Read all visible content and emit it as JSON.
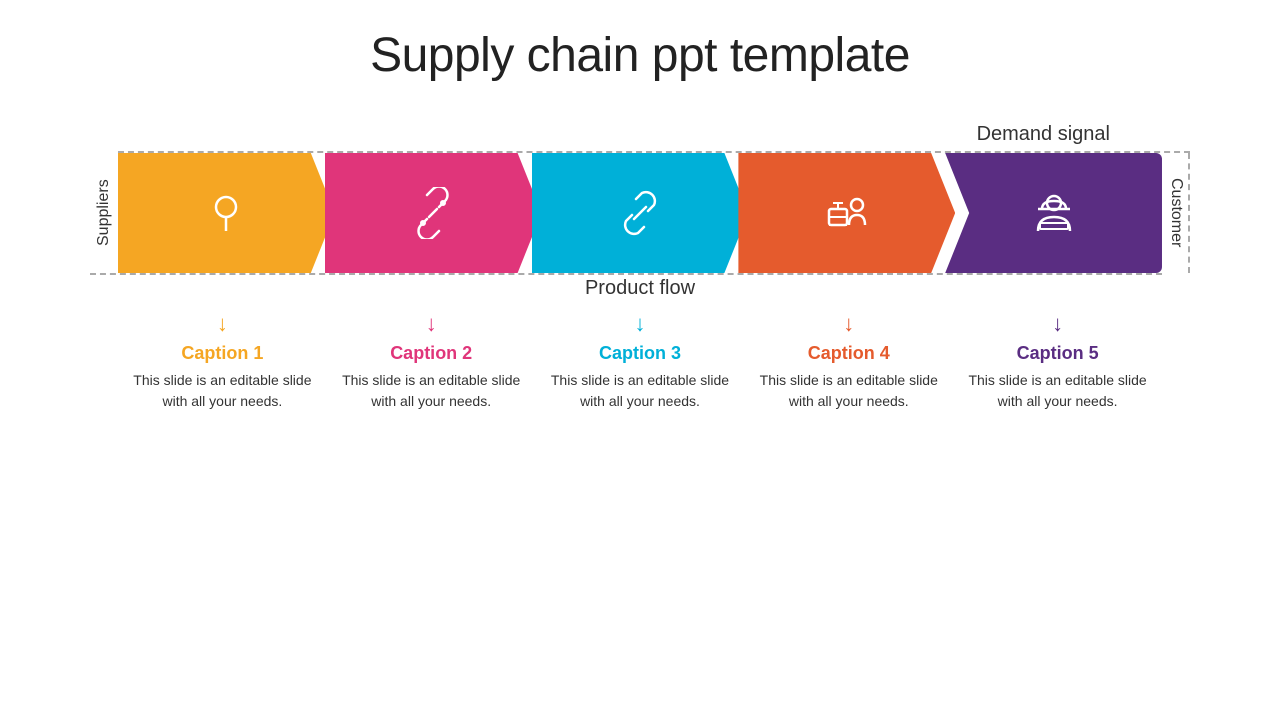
{
  "title": "Supply chain ppt template",
  "demand_label": "Demand signal",
  "product_label": "Product flow",
  "left_label": "Suppliers",
  "right_label": "Customer",
  "captions": [
    {
      "id": 1,
      "title": "Caption 1",
      "color": "#F5A623",
      "arrow_color": "#F5A623",
      "text": "This slide is an editable slide with all your needs."
    },
    {
      "id": 2,
      "title": "Caption 2",
      "color": "#E0357A",
      "arrow_color": "#E0357A",
      "text": "This slide is an editable slide with all your needs."
    },
    {
      "id": 3,
      "title": "Caption 3",
      "color": "#00B0D8",
      "arrow_color": "#00B0D8",
      "text": "This slide is an editable slide with all your needs."
    },
    {
      "id": 4,
      "title": "Caption 4",
      "color": "#E55B2D",
      "arrow_color": "#E55B2D",
      "text": "This slide is an editable slide with all your needs."
    },
    {
      "id": 5,
      "title": "Caption 5",
      "color": "#5A2D82",
      "arrow_color": "#5A2D82",
      "text": "This slide is an editable slide with all your needs."
    }
  ]
}
